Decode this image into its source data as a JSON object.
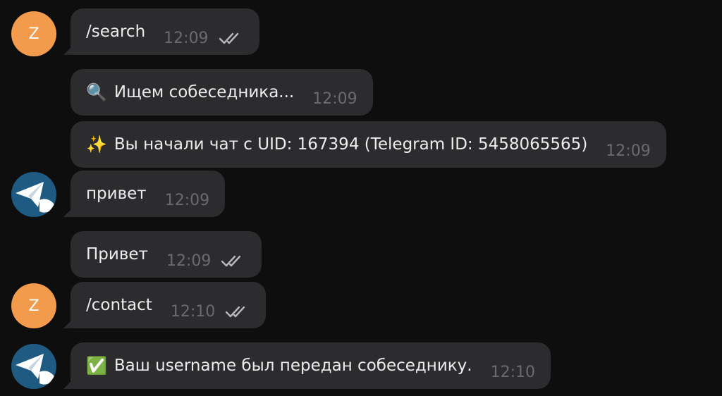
{
  "messages": [
    {
      "id": "m1",
      "text": "/search",
      "time": "12:09",
      "ticks": true
    },
    {
      "id": "m2",
      "emoji": "🔍",
      "text": "Ищем собеседника...",
      "time": "12:09"
    },
    {
      "id": "m3",
      "emoji": "✨",
      "text": "Вы начали чат с UID: 167394 (Telegram ID: 5458065565)",
      "time": "12:09"
    },
    {
      "id": "m4",
      "text": "привет",
      "time": "12:09"
    },
    {
      "id": "m5",
      "text": "Привет",
      "time": "12:09",
      "ticks": true
    },
    {
      "id": "m6",
      "text": "/contact",
      "time": "12:10",
      "ticks": true
    },
    {
      "id": "m7",
      "emoji": "✅",
      "text": "Ваш username был передан собеседнику.",
      "time": "12:10"
    }
  ],
  "avatars": {
    "user_letter": "Z"
  },
  "colors": {
    "background": "#0e0e0e",
    "bubble": "#2c2c2e",
    "user_avatar": "#f29b4c",
    "bot_avatar": "#1e5a82"
  },
  "icons": {
    "read_status": "double-check-icon",
    "bot_avatar": "paper-plane-icon"
  }
}
